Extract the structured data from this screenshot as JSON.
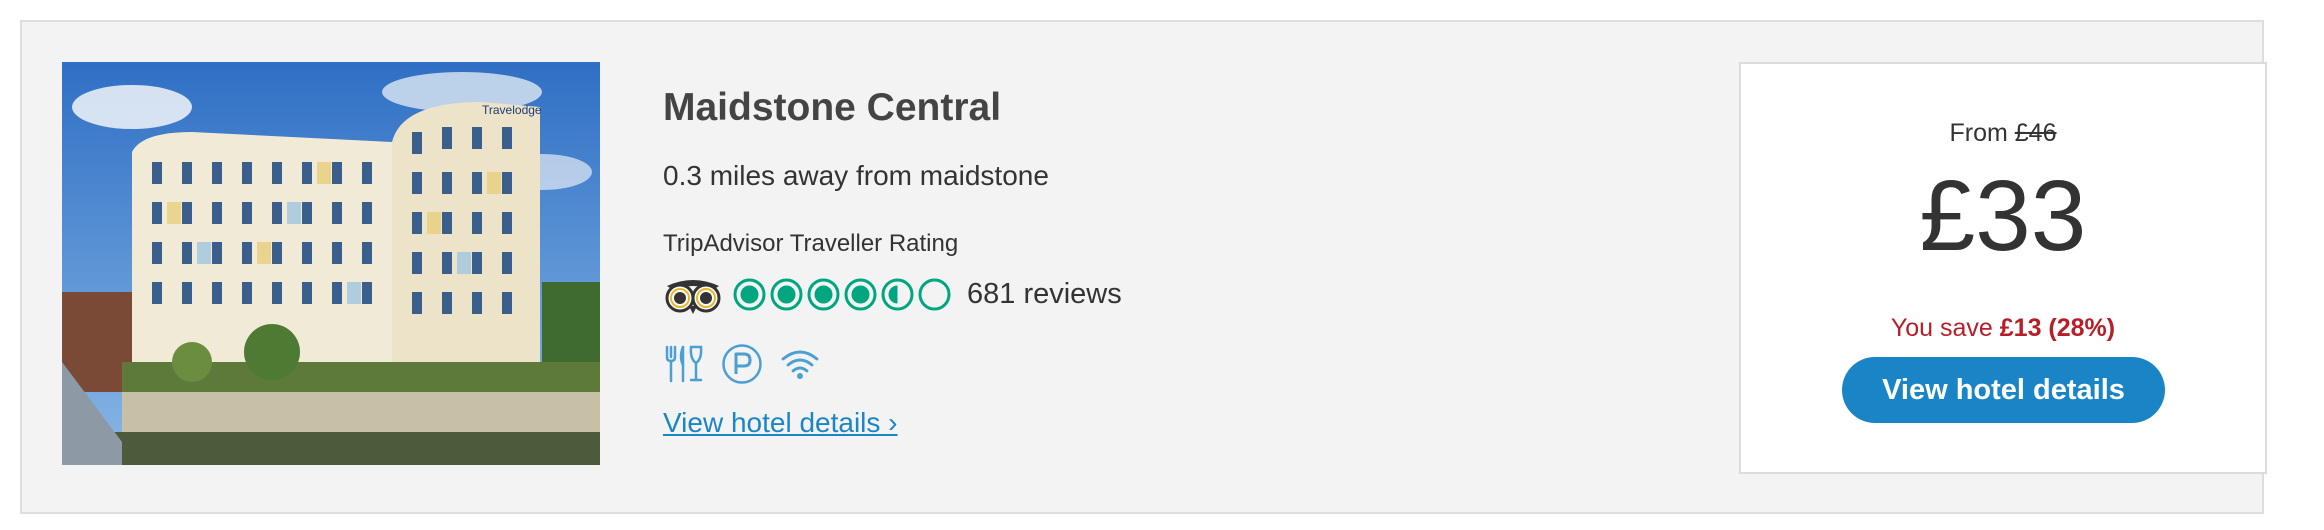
{
  "hotel": {
    "name": "Maidstone Central",
    "distance": "0.3 miles away from maidstone",
    "photo_icon": "hotel-photo"
  },
  "rating": {
    "label": "TripAdvisor Traveller Rating",
    "score": 4.5,
    "max": 5,
    "reviews": "681 reviews",
    "icon": "tripadvisor-owl-icon",
    "color": "#00a680"
  },
  "amenities": [
    {
      "name": "restaurant-icon"
    },
    {
      "name": "parking-icon"
    },
    {
      "name": "wifi-icon"
    }
  ],
  "amenity_color": "#4a9fd3",
  "details_link": "View hotel details ›",
  "price": {
    "from_label": "From",
    "old_price": "£46",
    "current": "£33",
    "save_label": "You save",
    "save_amount": "£13 (28%)",
    "save_color": "#b61f28"
  },
  "cta": {
    "label": "View hotel details",
    "color": "#1a85c6"
  }
}
